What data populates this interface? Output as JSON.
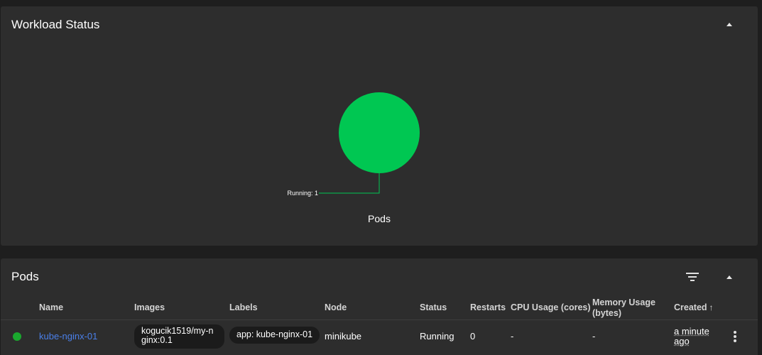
{
  "workload_status": {
    "title": "Workload Status",
    "collapse_icon": "chevron-up-icon"
  },
  "chart_data": {
    "type": "pie",
    "title": "Pods",
    "slices": [
      {
        "label": "Running",
        "value": 1,
        "color": "#00c752"
      }
    ],
    "callout_text": "Running: 1"
  },
  "pods": {
    "title": "Pods",
    "filter_icon": "filter-icon",
    "collapse_icon": "chevron-up-icon",
    "columns": {
      "name": "Name",
      "images": "Images",
      "labels": "Labels",
      "node": "Node",
      "status": "Status",
      "restarts": "Restarts",
      "cpu": "CPU Usage (cores)",
      "memory": "Memory Usage (bytes)",
      "created": "Created",
      "created_sort_icon": "arrow-up-icon",
      "created_sort_glyph": "↑"
    },
    "rows": [
      {
        "status_color": "#1aa82e",
        "name": "kube-nginx-01",
        "image": "kogucik1519/my-nginx:0.1",
        "image_line1": "kogucik1519/my-n",
        "image_line2": "ginx:0.1",
        "label": "app: kube-nginx-01",
        "node": "minikube",
        "status": "Running",
        "restarts": "0",
        "cpu": "-",
        "memory": "-",
        "created_line1": "a minute",
        "created_line2": "ago",
        "menu_icon": "more-vert-icon"
      }
    ]
  },
  "colors": {
    "background": "#1e1e1e",
    "card": "#2d2d2d",
    "running": "#00c752",
    "link": "#4a7fe8"
  }
}
